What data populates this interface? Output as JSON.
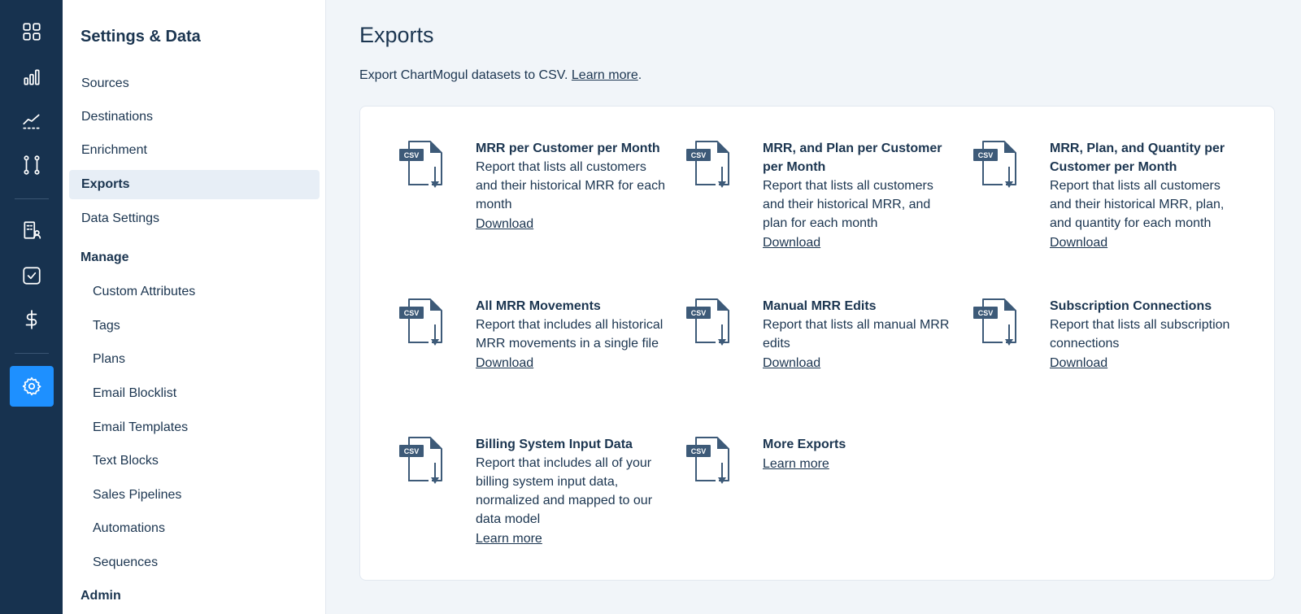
{
  "rail": {
    "icons": [
      "dashboard-icon",
      "bar-chart-icon",
      "trend-line-icon",
      "pipeline-icon",
      "buildings-icon",
      "checkbox-icon",
      "dollar-icon",
      "gear-icon"
    ],
    "active": "gear-icon"
  },
  "sidebar": {
    "title": "Settings & Data",
    "items": [
      {
        "label": "Sources"
      },
      {
        "label": "Destinations"
      },
      {
        "label": "Enrichment"
      },
      {
        "label": "Exports"
      },
      {
        "label": "Data Settings"
      }
    ],
    "manage_heading": "Manage",
    "manage_items": [
      {
        "label": "Custom Attributes"
      },
      {
        "label": "Tags"
      },
      {
        "label": "Plans"
      },
      {
        "label": "Email Blocklist"
      },
      {
        "label": "Email Templates"
      },
      {
        "label": "Text Blocks"
      },
      {
        "label": "Sales Pipelines"
      },
      {
        "label": "Automations"
      },
      {
        "label": "Sequences"
      }
    ],
    "admin_heading": "Admin"
  },
  "main": {
    "title": "Exports",
    "intro_text": "Export ChartMogul datasets to CSV.",
    "intro_link": "Learn more",
    "intro_end": ".",
    "csv_label": "CSV",
    "exports": [
      {
        "name": "MRR per Customer per Month",
        "description": "Report that lists all customers and their historical MRR for each month",
        "link": "Download"
      },
      {
        "name": "MRR, and Plan per Customer per Month",
        "description": "Report that lists all customers and their historical MRR, and plan for each month",
        "link": "Download"
      },
      {
        "name": "MRR, Plan, and Quantity per Customer per Month",
        "description": "Report that lists all customers and their historical MRR, plan, and quantity for each month",
        "link": "Download"
      },
      {
        "name": "All MRR Movements",
        "description": "Report that includes all historical MRR movements in a single file",
        "link": "Download"
      },
      {
        "name": "Manual MRR Edits",
        "description": "Report that lists all manual MRR edits",
        "link": "Download"
      },
      {
        "name": "Subscription Connections",
        "description": "Report that lists all subscription connections",
        "link": "Download"
      },
      {
        "name": "Billing System Input Data",
        "description": "Report that includes all of your billing system input data, normalized and mapped to our data model",
        "link": "Learn more"
      },
      {
        "name": "More Exports",
        "description": "",
        "link": "Learn more"
      }
    ]
  },
  "colors": {
    "rail_bg": "#17324f",
    "accent": "#1e90ff",
    "text": "#1b3550",
    "active_nav_bg": "#e7eef6",
    "page_bg": "#f1f5f9"
  }
}
